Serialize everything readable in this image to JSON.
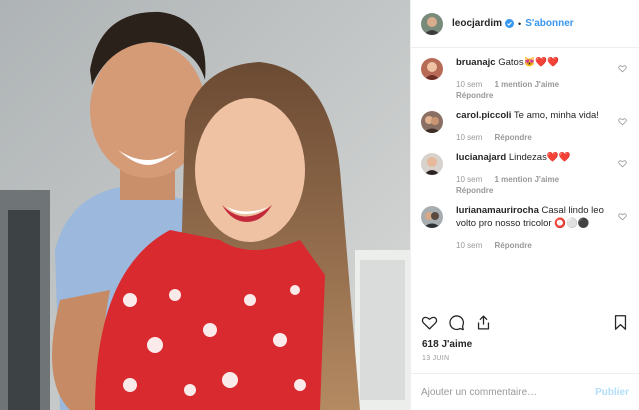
{
  "post": {
    "photo_alt": "Couple selfie",
    "username": "leocjardim",
    "separator": "•",
    "follow_label": "S'abonner",
    "likes": "618 J'aime",
    "date": "13 JUIN"
  },
  "comments": [
    {
      "user": "bruanajc",
      "text": "Gatos😻❤️❤️",
      "time": "10 sem",
      "likes": "1 mention J'aime",
      "reply": "Répondre"
    },
    {
      "user": "carol.piccoli",
      "text": "Te amo, minha vida!",
      "time": "10 sem",
      "likes": "",
      "reply": "Répondre"
    },
    {
      "user": "lucianajard",
      "text": "Lindezas❤️❤️",
      "time": "10 sem",
      "likes": "1 mention J'aime",
      "reply": "Répondre"
    },
    {
      "user": "lurianamaurirocha",
      "text": "Casal lindo leo volto pro nosso tricolor ⭕⚪⚫",
      "time": "10 sem",
      "likes": "",
      "reply": "Répondre"
    }
  ],
  "add_comment": {
    "placeholder": "Ajouter un commentaire…",
    "publish_label": "Publier"
  },
  "icons": {
    "like": "heart-icon",
    "comment": "comment-icon",
    "share": "share-icon",
    "save": "bookmark-icon",
    "verified": "verified-badge-icon"
  },
  "colors": {
    "accent": "#3897f0",
    "publish_disabled": "#b2dffc",
    "muted": "#999999"
  }
}
